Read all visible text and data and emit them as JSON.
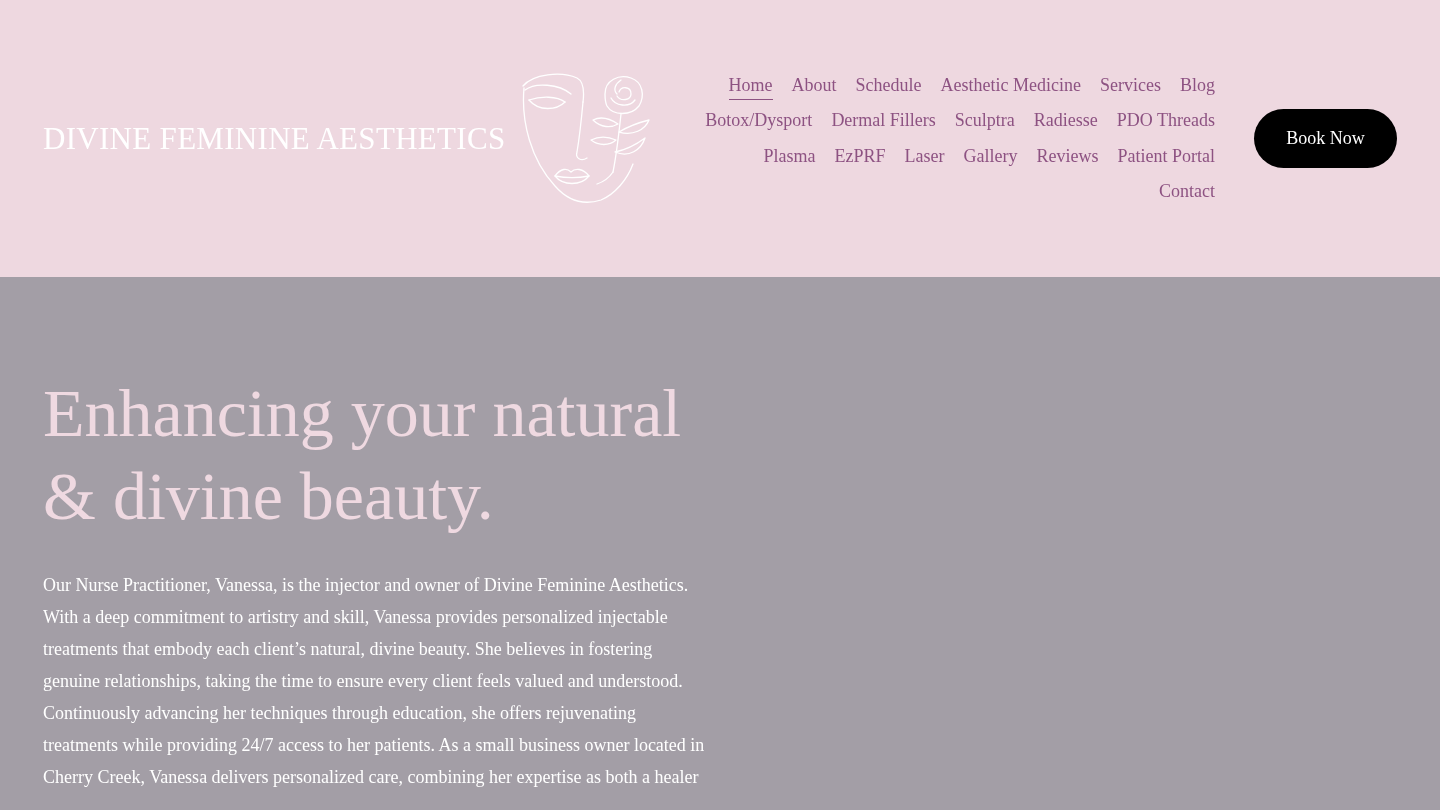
{
  "header": {
    "logo": {
      "text": "DIVINE FEMININE AESTHETICS"
    },
    "nav": {
      "items": [
        {
          "label": "Home",
          "selected": true
        },
        {
          "label": "About",
          "selected": false
        },
        {
          "label": "Schedule",
          "selected": false
        },
        {
          "label": "Aesthetic Medicine",
          "selected": false
        },
        {
          "label": "Services",
          "selected": false
        },
        {
          "label": "Blog",
          "selected": false
        },
        {
          "label": "Botox/Dysport",
          "selected": false
        },
        {
          "label": "Dermal Fillers",
          "selected": false
        },
        {
          "label": "Sculptra",
          "selected": false
        },
        {
          "label": "Radiesse",
          "selected": false
        },
        {
          "label": "PDO Threads",
          "selected": false
        },
        {
          "label": "Plasma",
          "selected": false
        },
        {
          "label": "EzPRF",
          "selected": false
        },
        {
          "label": "Laser",
          "selected": false
        },
        {
          "label": "Gallery",
          "selected": false
        },
        {
          "label": "Reviews",
          "selected": false
        },
        {
          "label": "Patient Portal",
          "selected": false
        },
        {
          "label": "Contact",
          "selected": false
        }
      ]
    },
    "cta_button": "Book Now"
  },
  "hero": {
    "heading": "Enhancing your natural & divine beauty.",
    "body": "Our Nurse Practitioner, Vanessa, is the injector and owner of Divine Feminine Aesthetics. With a deep commitment to artistry and skill, Vanessa provides personalized injectable treatments that embody each client’s natural, divine beauty. She believes in fostering genuine relationships, taking the time to ensure every client feels valued and understood. Continuously advancing her techniques through education, she offers rejuvenating treatments while providing 24/7 access to her patients. As a small business owner located in Cherry Creek, Vanessa delivers personalized care, combining her expertise as both a healer"
  }
}
